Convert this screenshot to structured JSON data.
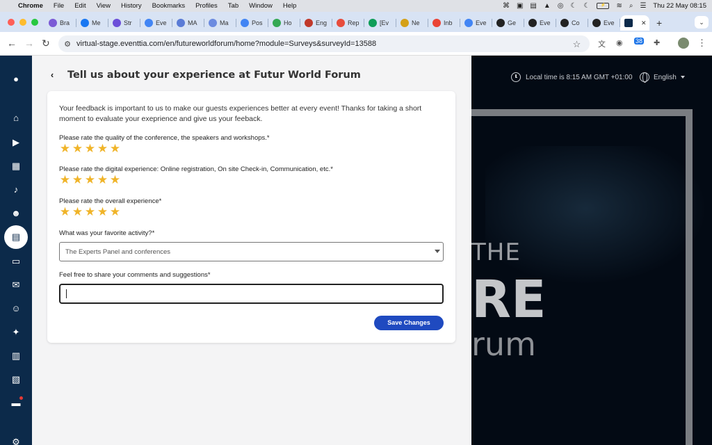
{
  "menubar": {
    "app": "Chrome",
    "items": [
      "File",
      "Edit",
      "View",
      "History",
      "Bookmarks",
      "Profiles",
      "Tab",
      "Window",
      "Help"
    ],
    "datetime": "Thu 22 May  08:15",
    "battery_label": "⚡"
  },
  "tabs": [
    {
      "label": "Bra",
      "color": "#7b5bd6"
    },
    {
      "label": "Me",
      "color": "#1877f2"
    },
    {
      "label": "Str",
      "color": "#6c4fd9"
    },
    {
      "label": "Eve",
      "color": "#4285f4"
    },
    {
      "label": "MA",
      "color": "#5a7bd6"
    },
    {
      "label": "Ma",
      "color": "#6c8be0"
    },
    {
      "label": "Pos",
      "color": "#4285f4"
    },
    {
      "label": "Ho",
      "color": "#34a853"
    },
    {
      "label": "Eng",
      "color": "#c0392b"
    },
    {
      "label": "Rep",
      "color": "#e74c3c"
    },
    {
      "label": "[Ev",
      "color": "#0f9d58"
    },
    {
      "label": "Ne",
      "color": "#d4a017"
    },
    {
      "label": "Inb",
      "color": "#ea4335"
    },
    {
      "label": "Eve",
      "color": "#4285f4"
    },
    {
      "label": "Ge",
      "color": "#222222"
    },
    {
      "label": "Eve",
      "color": "#222222"
    },
    {
      "label": "Co",
      "color": "#222222"
    },
    {
      "label": "Eve",
      "color": "#222222"
    }
  ],
  "active_tab": {
    "color": "#0c2a4a"
  },
  "toolbar": {
    "url": "virtual-stage.eventtia.com/en/futureworldforum/home?module=Surveys&surveyId=13588",
    "badge": "38"
  },
  "main": {
    "title": "Tell us about your experience at Futur World Forum",
    "intro": "Your feedback is important to us to make our guests experiences better at every event! Thanks for taking a short moment to evaluate your exeprience and give us your feeback.",
    "q1": {
      "label": "Please rate the quality of the conference, the speakers and workshops.*",
      "rating": 5,
      "max": 5
    },
    "q2": {
      "label": "Please rate the digital experience: Online registration, On site Check-in, Communication, etc.*",
      "rating": 5,
      "max": 5
    },
    "q3": {
      "label": "Please rate the overall experience*",
      "rating": 5,
      "max": 5
    },
    "q4": {
      "label": "What was your favorite activity?*",
      "selected": "The Experts Panel and conferences"
    },
    "q5": {
      "label": "Feel free to share your comments and suggestions*",
      "value": ""
    },
    "save_label": "Save Changes",
    "accent": "#1f4ac0",
    "star_color": "#f0b429"
  },
  "hero": {
    "local_time": "Local time is 8:15 AM GMT +01:00",
    "language": "English",
    "line1": "THE",
    "line2": "RE",
    "line3": "rum"
  }
}
